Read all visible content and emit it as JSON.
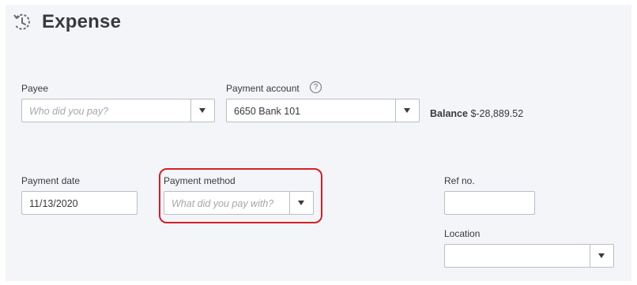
{
  "header": {
    "title": "Expense",
    "icon": "expense-icon"
  },
  "payee": {
    "label": "Payee",
    "placeholder": "Who did you pay?",
    "value": ""
  },
  "payment_account": {
    "label": "Payment account",
    "value": "6650 Bank 101",
    "help_icon": "help-circle-icon"
  },
  "balance": {
    "label": "Balance",
    "value": "$-28,889.52"
  },
  "payment_date": {
    "label": "Payment date",
    "value": "11/13/2020"
  },
  "payment_method": {
    "label": "Payment method",
    "placeholder": "What did you pay with?",
    "value": "",
    "highlight_color": "#d32027"
  },
  "ref_no": {
    "label": "Ref no.",
    "value": ""
  },
  "location": {
    "label": "Location",
    "value": ""
  },
  "colors": {
    "panel_background": "#f4f5f8",
    "text": "#393a3d",
    "border": "#babec5"
  }
}
